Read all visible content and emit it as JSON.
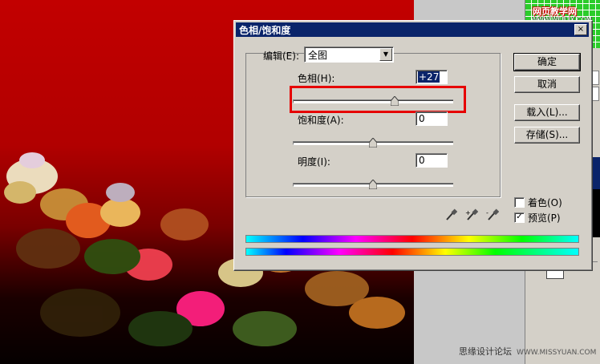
{
  "dialog": {
    "title": "色相/饱和度",
    "close_glyph": "×",
    "edit_label": "编辑(E):",
    "edit_value": "全图",
    "dropdown_glyph": "▼",
    "hue_label": "色相(H):",
    "hue_value": "+27",
    "saturation_label": "饱和度(A):",
    "saturation_value": "0",
    "lightness_label": "明度(I):",
    "lightness_value": "0",
    "hue_slider_fraction": 0.64,
    "saturation_slider_fraction": 0.5,
    "lightness_slider_fraction": 0.5,
    "buttons": {
      "ok": "确定",
      "cancel": "取消",
      "load": "载入(L)...",
      "save": "存储(S)..."
    },
    "colorize_label": "着色(O)",
    "colorize_checked": false,
    "preview_label": "预览(P)",
    "preview_checked": true,
    "checkmark": "✓",
    "highlight_color": "#e60000",
    "titlebar_color": "#0a246a"
  },
  "icons": [
    "eyedropper-icon",
    "eyedropper-plus-icon",
    "eyedropper-minus-icon"
  ],
  "watermark": {
    "logo": "网页教学网",
    "logo_url": "WWW.WEB3X.COM",
    "bottom_text": "思缘设计论坛",
    "bottom_url": "WWW.MISSYUAN.COM"
  }
}
